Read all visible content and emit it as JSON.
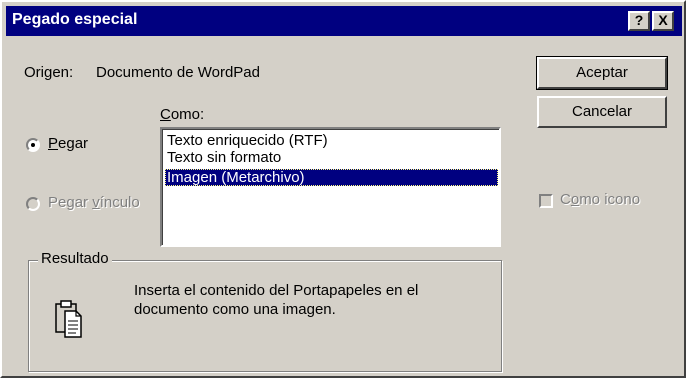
{
  "window": {
    "title": "Pegado especial",
    "help_button": "?",
    "close_button": "X"
  },
  "origin": {
    "label": "Origen:",
    "value": "Documento de WordPad"
  },
  "como": {
    "label": "Como:",
    "items": [
      {
        "label": "Texto enriquecido (RTF)",
        "selected": false
      },
      {
        "label": "Texto sin formato",
        "selected": false
      },
      {
        "label": "Imagen (Metarchivo)",
        "selected": true
      }
    ]
  },
  "options": {
    "paste": {
      "label": "Pegar",
      "checked": true,
      "enabled": true
    },
    "paste_link": {
      "label": "Pegar vínculo",
      "checked": false,
      "enabled": false
    }
  },
  "buttons": {
    "accept": "Aceptar",
    "cancel": "Cancelar"
  },
  "display_as_icon": {
    "label": "Como icono",
    "checked": false,
    "enabled": false
  },
  "result": {
    "label": "Resultado",
    "text_line1": "Inserta el contenido del Portapapeles en el",
    "text_line2": "documento como una imagen.",
    "icon": "clipboard-icon"
  },
  "colors": {
    "face": "#d4d0c8",
    "title_bar": "#000080",
    "selection": "#000080"
  }
}
